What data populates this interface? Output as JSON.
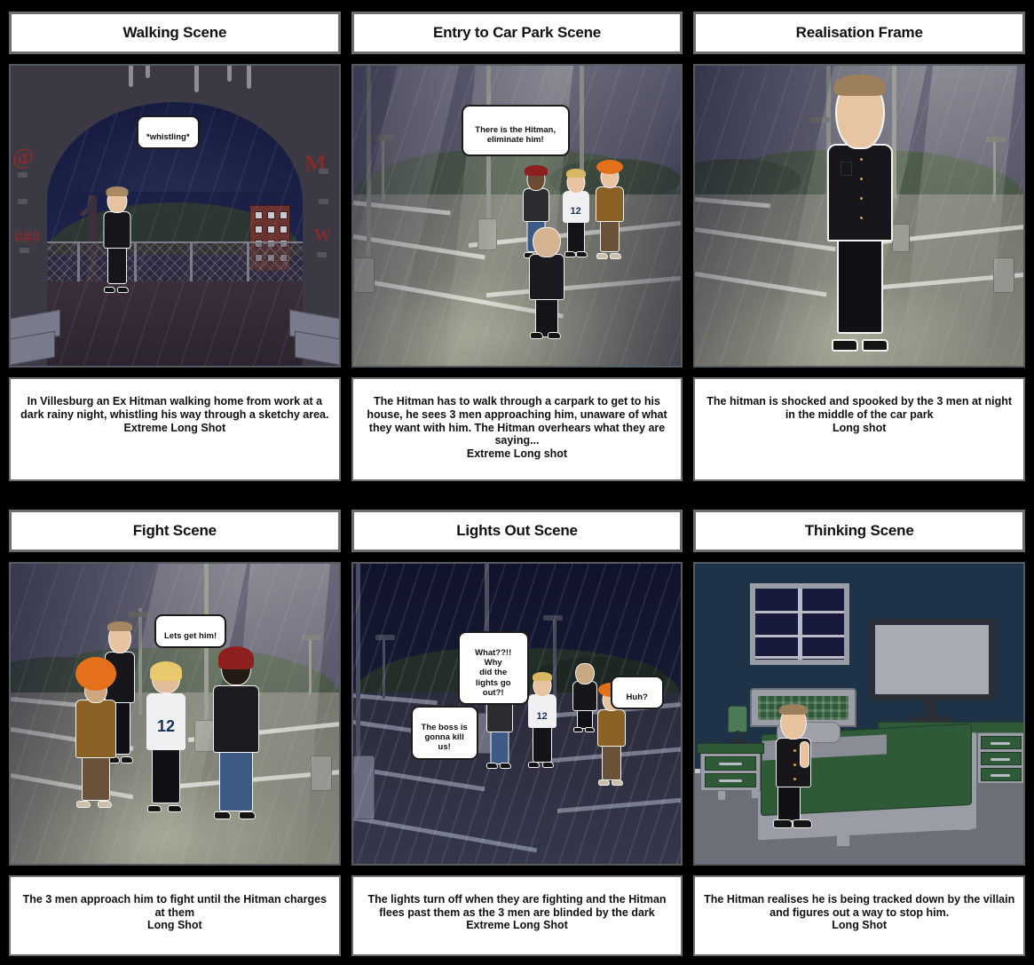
{
  "board": {
    "background_color": "#000000",
    "panel_border_color": "#6e6e6e",
    "columns": 3,
    "rows": 2
  },
  "panels": [
    {
      "id": "panel-1",
      "title": "Walking Scene",
      "caption": "In Villesburg an Ex Hitman walking home from work at a dark rainy night, whistling his way through a sketchy area.\nExtreme Long Shot",
      "shot_type": "Extreme Long Shot",
      "scene": "tunnel-underpass-night-rain",
      "bubbles": [
        {
          "text": "*whistling*"
        }
      ],
      "characters": [
        "hitman"
      ]
    },
    {
      "id": "panel-2",
      "title": "Entry to Car Park Scene",
      "caption": "The Hitman has to walk through a carpark to get to his house, he sees 3 men approaching him, unaware of what they want with him. The Hitman overhears what they are saying...\nExtreme Long shot",
      "shot_type": "Extreme Long shot",
      "scene": "car-park-dusk-rain",
      "bubbles": [
        {
          "text": "There is the Hitman,\neliminate him!"
        }
      ],
      "characters": [
        "hitman",
        "man-red-hair",
        "man-jersey-12",
        "man-orange-hair"
      ]
    },
    {
      "id": "panel-3",
      "title": "Realisation Frame",
      "caption": "The hitman is shocked and spooked by the 3 men at night in the middle of the car park\nLong shot",
      "shot_type": "Long shot",
      "scene": "car-park-dusk-rain-closeup",
      "bubbles": [],
      "characters": [
        "hitman-shocked"
      ]
    },
    {
      "id": "panel-4",
      "title": "Fight Scene",
      "caption": "The 3 men approach him to fight until the Hitman charges at them\nLong Shot",
      "shot_type": "Long Shot",
      "scene": "car-park-dusk-rain",
      "bubbles": [
        {
          "text": "Lets get him!"
        }
      ],
      "characters": [
        "hitman-angry",
        "man-orange-hair",
        "man-jersey-12",
        "man-red-hair"
      ]
    },
    {
      "id": "panel-5",
      "title": "Lights Out Scene",
      "caption": "The lights turn off when they are fighting and the Hitman flees past them as the 3 men are blinded by the dark\nExtreme Long Shot",
      "shot_type": "Extreme Long Shot",
      "scene": "car-park-night-dark-rain",
      "bubbles": [
        {
          "text": "What??!! Why\ndid the lights go\nout?!"
        },
        {
          "text": "The boss is\ngonna kill us!"
        },
        {
          "text": "Huh?"
        }
      ],
      "characters": [
        "man-red-hair",
        "man-jersey-12",
        "hitman-fleeing",
        "man-orange-hair"
      ]
    },
    {
      "id": "panel-6",
      "title": "Thinking Scene",
      "caption": "The Hitman realises he is being tracked down by the villain and figures out a way to stop him.\nLong Shot",
      "shot_type": "Long Shot",
      "scene": "bedroom-night",
      "bubbles": [],
      "characters": [
        "hitman-thinking"
      ]
    }
  ],
  "jersey": {
    "number": "12"
  },
  "graffiti": {
    "left_top": "@",
    "left_bottom": "###",
    "right_top": "M",
    "right_bottom": "W"
  }
}
